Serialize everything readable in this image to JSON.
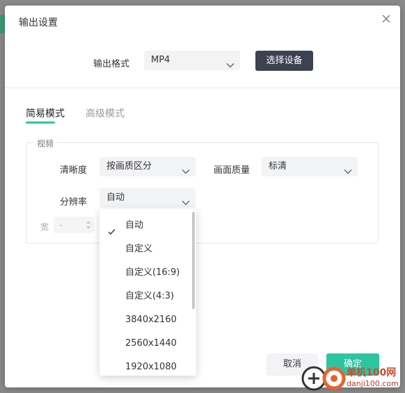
{
  "dialog": {
    "title": "输出设置",
    "format_label": "输出格式",
    "format_value": "MP4",
    "device_button": "选择设备"
  },
  "tabs": [
    {
      "label": "简易模式",
      "active": true
    },
    {
      "label": "高级模式",
      "active": false
    }
  ],
  "video": {
    "legend": "视频",
    "clarity_label": "清晰度",
    "clarity_value": "按画质区分",
    "quality_label": "画面质量",
    "quality_value": "标清",
    "resolution_label": "分辨率",
    "resolution_value": "自动",
    "width_label": "宽",
    "width_value": "-"
  },
  "dropdown": {
    "selected": "自动",
    "options": [
      "自动",
      "自定义",
      "自定义(16:9)",
      "自定义(4:3)",
      "3840x2160",
      "2560x1440",
      "1920x1080"
    ]
  },
  "footer": {
    "cancel": "取消",
    "confirm": "确定"
  },
  "watermark": {
    "line1": "单机100网",
    "line2": "danji100.com"
  },
  "colors": {
    "accent": "#2ec4a0",
    "dark_button": "#3d4152"
  }
}
